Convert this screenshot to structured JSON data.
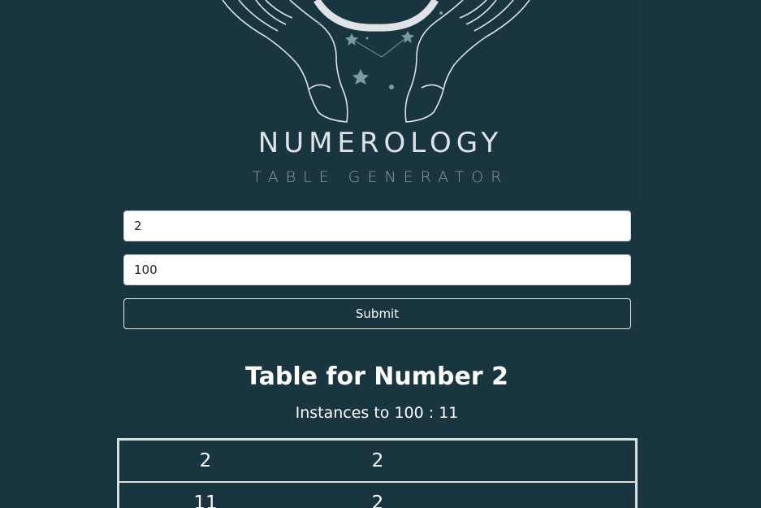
{
  "brand": {
    "title": "NUMEROLOGY",
    "subtitle": "TABLE GENERATOR"
  },
  "form": {
    "number_value": "2",
    "limit_value": "100",
    "submit_label": "Submit"
  },
  "result": {
    "title": "Table for Number 2",
    "count_prefix": "Instances to 100 : ",
    "count_value": "11"
  },
  "table": {
    "rows": [
      [
        "2",
        "2",
        ""
      ],
      [
        "11",
        "2",
        ""
      ]
    ]
  },
  "colors": {
    "background": "#193540",
    "logo_line": "#dfe3e6",
    "star": "#7f99a3"
  }
}
